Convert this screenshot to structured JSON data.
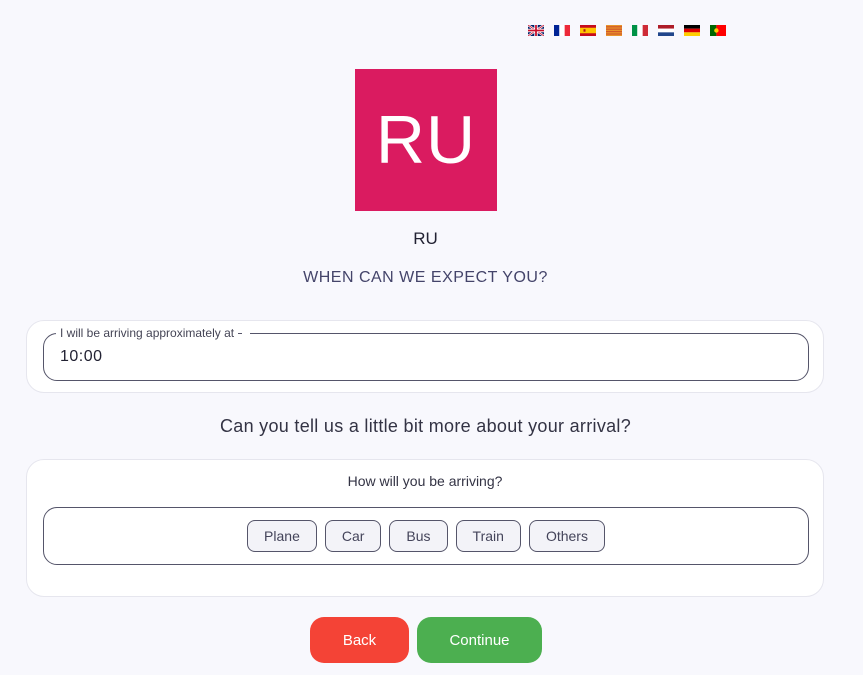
{
  "languages": [
    {
      "name": "English",
      "icon": "uk-flag-icon"
    },
    {
      "name": "French",
      "icon": "france-flag-icon"
    },
    {
      "name": "Spanish",
      "icon": "spain-flag-icon"
    },
    {
      "name": "Catalan",
      "icon": "catalonia-flag-icon"
    },
    {
      "name": "Italian",
      "icon": "italy-flag-icon"
    },
    {
      "name": "Dutch",
      "icon": "netherlands-flag-icon"
    },
    {
      "name": "German",
      "icon": "germany-flag-icon"
    },
    {
      "name": "Portuguese",
      "icon": "portugal-flag-icon"
    }
  ],
  "logo": {
    "text": "RU",
    "color": "#da1b60"
  },
  "hotel": {
    "name": "RU"
  },
  "step": {
    "title": "WHEN CAN WE EXPECT YOU?"
  },
  "arrival_time": {
    "label": "I will be arriving approximately at",
    "value": "10:00"
  },
  "details": {
    "question": "Can you tell us a little bit more about your arrival?"
  },
  "transport": {
    "label": "How will you be arriving?",
    "options": [
      "Plane",
      "Car",
      "Bus",
      "Train",
      "Others"
    ]
  },
  "buttons": {
    "back": {
      "label": "Back",
      "color": "#f44336"
    },
    "continue": {
      "label": "Continue",
      "color": "#4caf50"
    }
  }
}
